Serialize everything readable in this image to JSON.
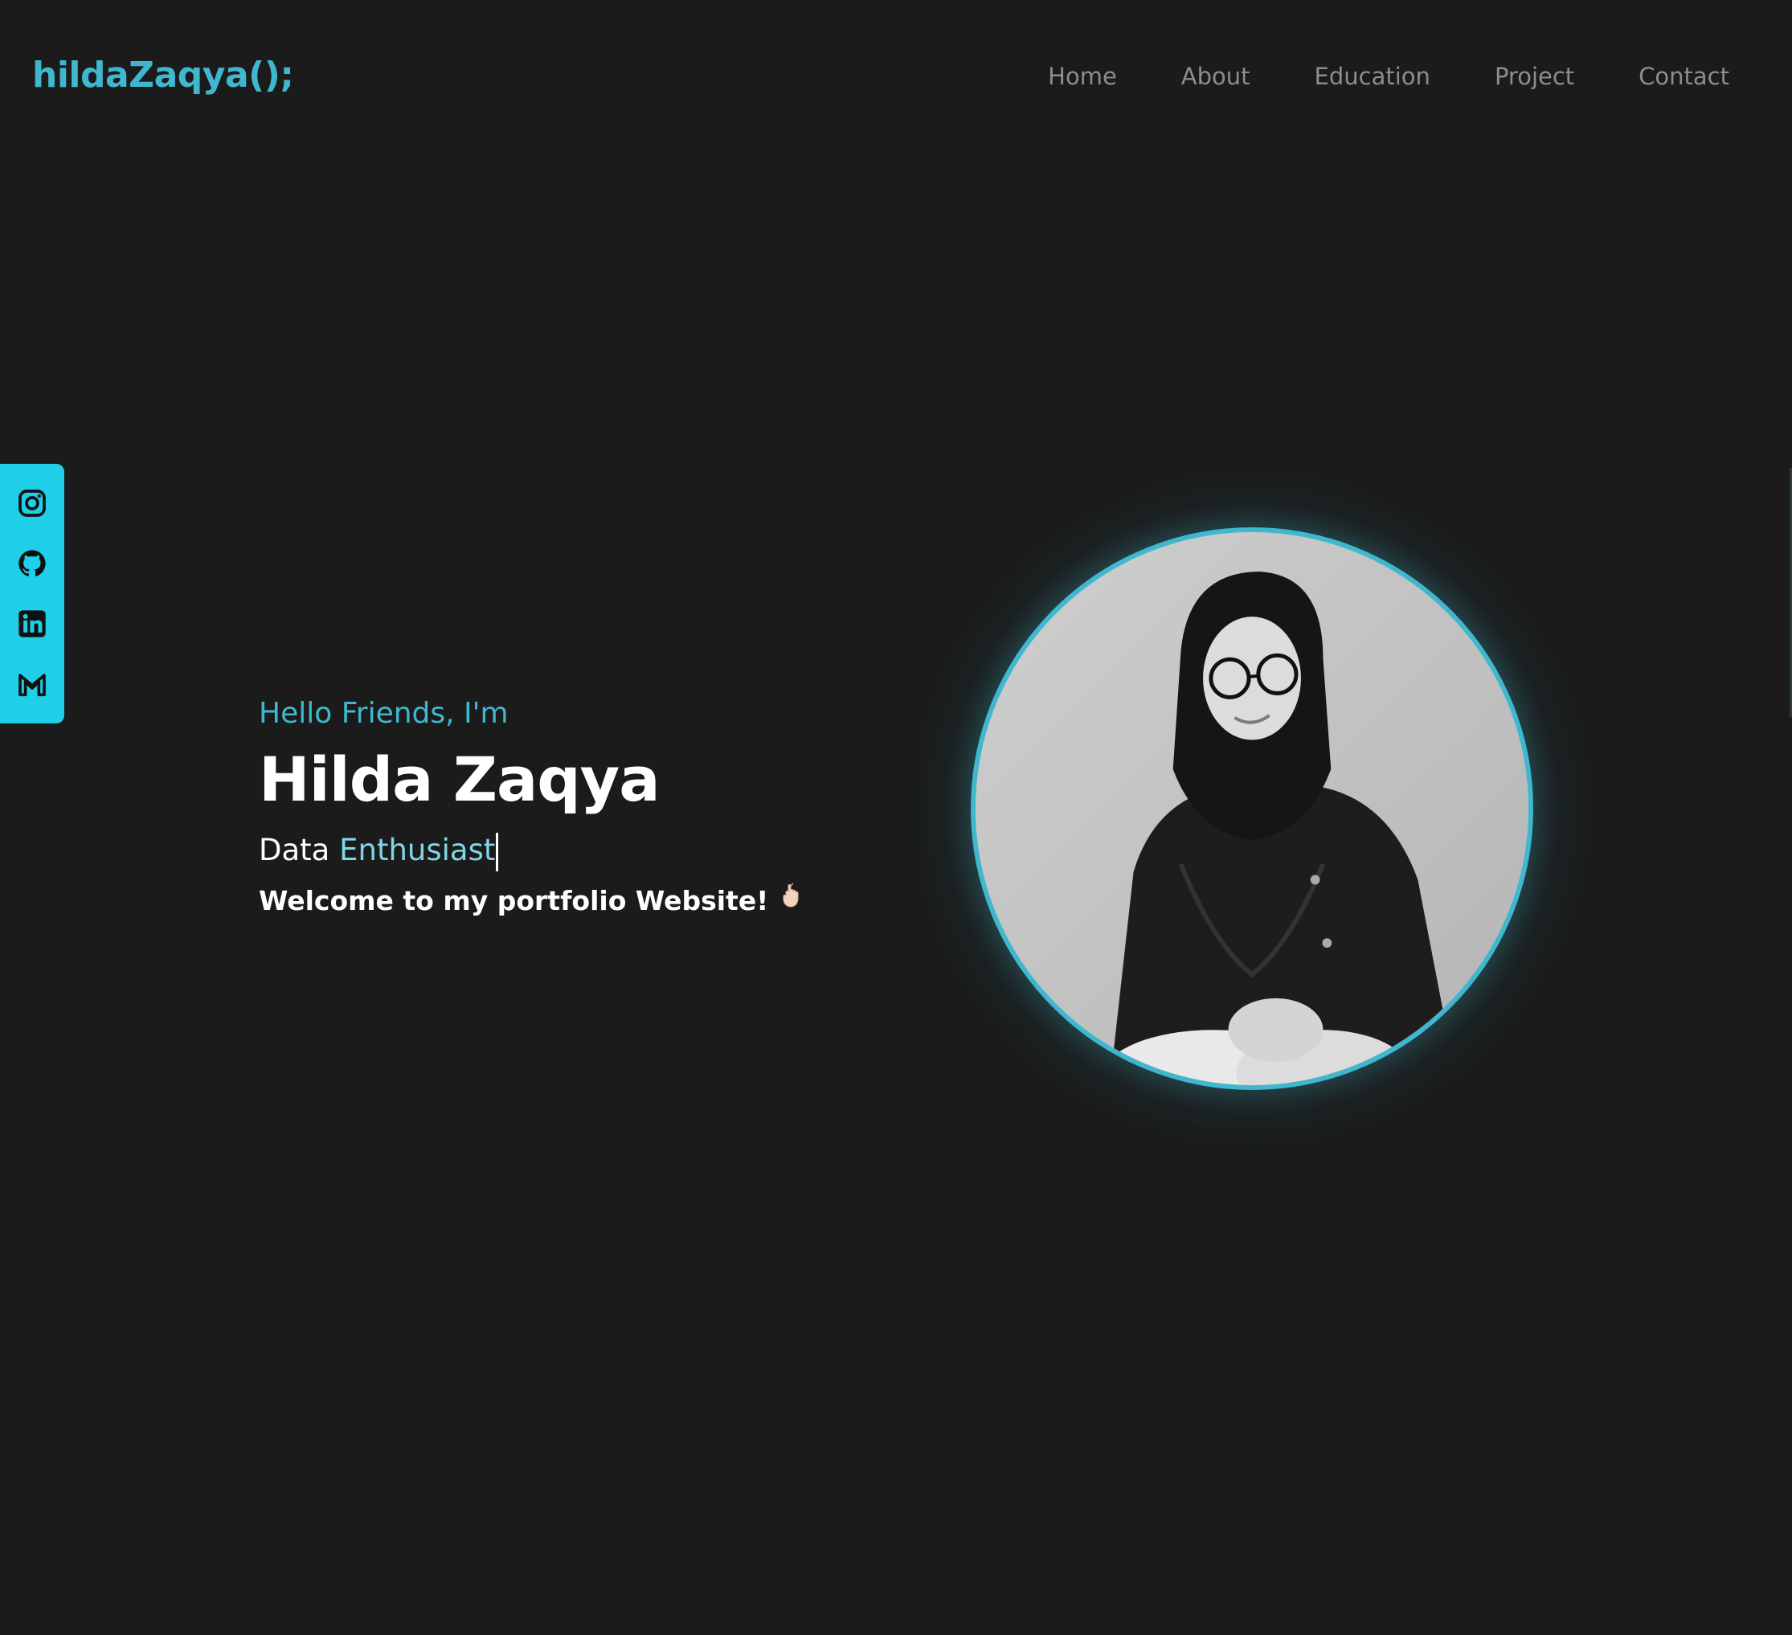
{
  "header": {
    "logo": "hildaZaqya();",
    "nav": [
      "Home",
      "About",
      "Education",
      "Project",
      "Contact"
    ]
  },
  "social": {
    "items": [
      "instagram-icon",
      "github-icon",
      "linkedin-icon",
      "gmail-icon"
    ],
    "background": "#1fcfe8"
  },
  "hero": {
    "greeting": "Hello Friends, I'm",
    "name": "Hilda Zaqya",
    "role_prefix": "Data",
    "role_typed": "Enthusiast",
    "welcome": "Welcome to my portfolio Website!",
    "emoji": "hand-emoji"
  },
  "colors": {
    "accent": "#3fb8cf",
    "background": "#1b1b1b",
    "nav_text": "#8d8d8d"
  }
}
